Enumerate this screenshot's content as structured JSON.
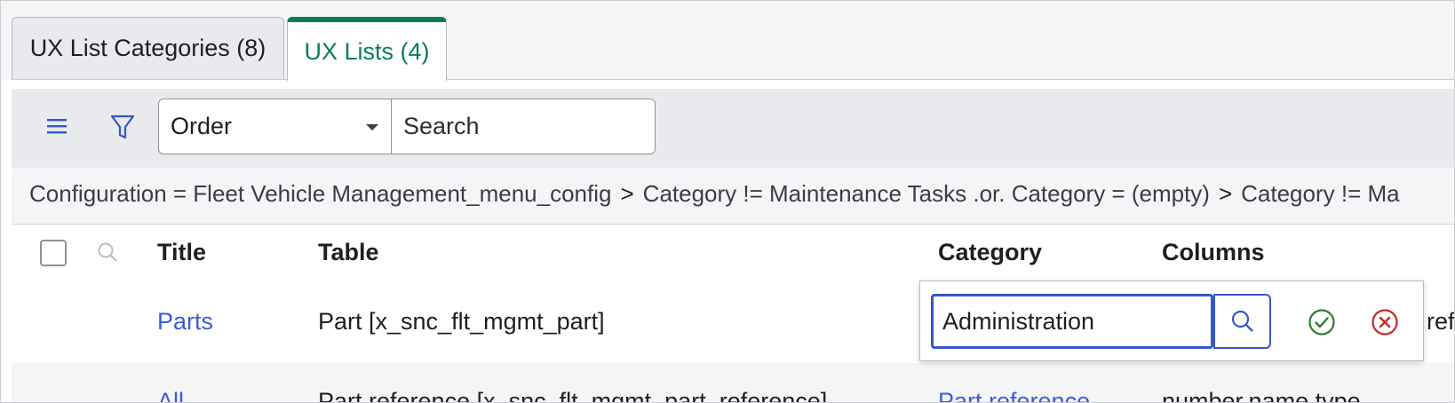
{
  "tabs": [
    {
      "label": "UX List Categories (8)",
      "active": false
    },
    {
      "label": "UX Lists (4)",
      "active": true
    }
  ],
  "toolbar": {
    "menu_icon": "hamburger-menu-icon",
    "filter_icon": "funnel-filter-icon",
    "sort_field": "Order",
    "search_placeholder": "Search"
  },
  "breadcrumbs": [
    "Configuration = Fleet Vehicle Management_menu_config",
    "Category != Maintenance Tasks .or. Category = (empty)",
    "Category != Ma"
  ],
  "breadcrumb_separator": ">",
  "table": {
    "columns": [
      "Title",
      "Table",
      "Category",
      "Columns"
    ],
    "rows": [
      {
        "title": "Parts",
        "table": "Part [x_snc_flt_mgmt_part]",
        "category": "Administration",
        "columns": "ref"
      },
      {
        "title": "All",
        "table": "Part reference [x_snc_flt_mgmt_part_reference]",
        "category": "Part reference",
        "columns": "number,name,type"
      }
    ]
  },
  "inline_editor": {
    "value": "Administration",
    "search_icon": "search-icon",
    "save_icon": "check-circle-icon",
    "cancel_icon": "x-circle-icon"
  },
  "colors": {
    "active_tab": "#0c7c5c",
    "link": "#3b5bdb",
    "focus_border": "#3458c8",
    "save": "#2e7d32",
    "cancel": "#c62828"
  }
}
